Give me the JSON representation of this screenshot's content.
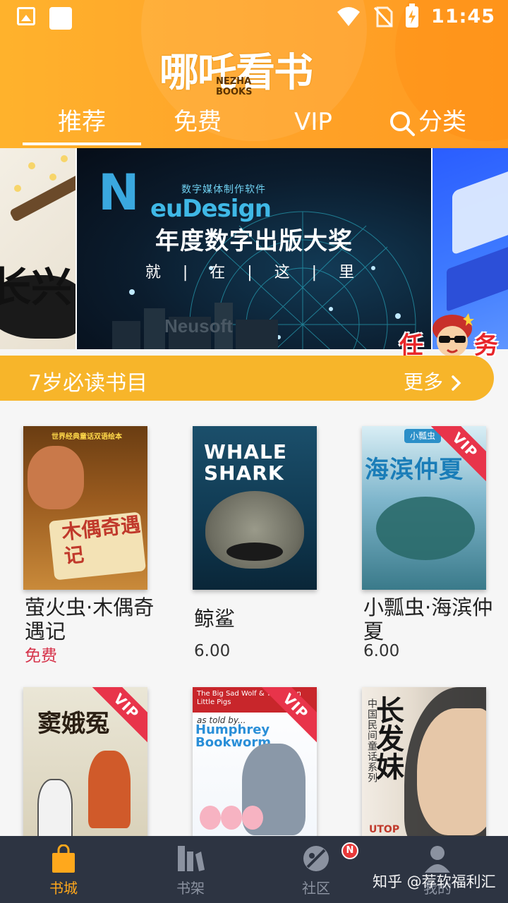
{
  "status_bar": {
    "time": "11:45",
    "icons": [
      "image-icon",
      "app-square-icon",
      "wifi-icon",
      "no-sim-icon",
      "battery-charging-icon"
    ]
  },
  "header": {
    "logo_text": "哪吒看书",
    "logo_sub_line1": "NEZHA",
    "logo_sub_line2": "BOOKS",
    "tabs": [
      {
        "label": "推荐",
        "active": true
      },
      {
        "label": "免费",
        "active": false
      },
      {
        "label": "VIP",
        "active": false
      },
      {
        "label": "分类",
        "active": false,
        "icon": "search-icon"
      }
    ]
  },
  "banner": {
    "left_calligraphy": "长兴",
    "brand_sub": "数字媒体制作软件",
    "brand_name": "euDesign",
    "brand_initial": "N",
    "headline": "年度数字出版大奖",
    "tagline": "就 | 在 | 这 | 里",
    "watermark": "Neusoft"
  },
  "task_badge": {
    "left_char": "任",
    "right_char": "务"
  },
  "section": {
    "title": "7岁必读书目",
    "more_label": "更多"
  },
  "books": [
    {
      "title": "萤火虫·木偶奇遇记",
      "price": "免费",
      "free": true,
      "vip": false,
      "cover_text": "木偶奇遇记",
      "cover_top": "世界经典童话双语绘本"
    },
    {
      "title": "鲸鲨",
      "price": "6.00",
      "free": false,
      "vip": false,
      "cover_text_line1": "WHALE",
      "cover_text_line2": "SHARK"
    },
    {
      "title": "小瓢虫·海滨仲夏",
      "price": "6.00",
      "free": false,
      "vip": true,
      "cover_text": "海滨仲夏",
      "cover_tag": "小瓢虫"
    },
    {
      "title": "",
      "price": "",
      "vip": true,
      "cover_text": "窦娥冤"
    },
    {
      "title": "",
      "price": "",
      "vip": true,
      "cover_top": "The Big Sad Wolf & The Mean Little Pigs",
      "cover_text_line1": "Humphrey",
      "cover_text_line2": "Bookworm",
      "cover_told": "as told by..."
    },
    {
      "title": "",
      "price": "",
      "vip": false,
      "cover_text": "长发妹",
      "cover_sub": "中国民间童话系列",
      "cover_brand": "UTOP"
    }
  ],
  "vip_ribbon_label": "VIP",
  "bottom_nav": [
    {
      "label": "书城",
      "icon": "shopping-bag-icon",
      "active": true
    },
    {
      "label": "书架",
      "icon": "bookshelf-icon",
      "active": false
    },
    {
      "label": "社区",
      "icon": "community-icon",
      "active": false,
      "badge": "N"
    },
    {
      "label": "我的",
      "icon": "profile-icon",
      "active": false
    }
  ],
  "watermark": "知乎 @荐软福利汇",
  "colors": {
    "header_orange": "#ffa52a",
    "section_bar": "#f7b52a",
    "free_price": "#d6334a",
    "vip_ribbon": "#e8344a",
    "nav_bg": "#2d3442",
    "nav_active": "#ffa81c"
  }
}
